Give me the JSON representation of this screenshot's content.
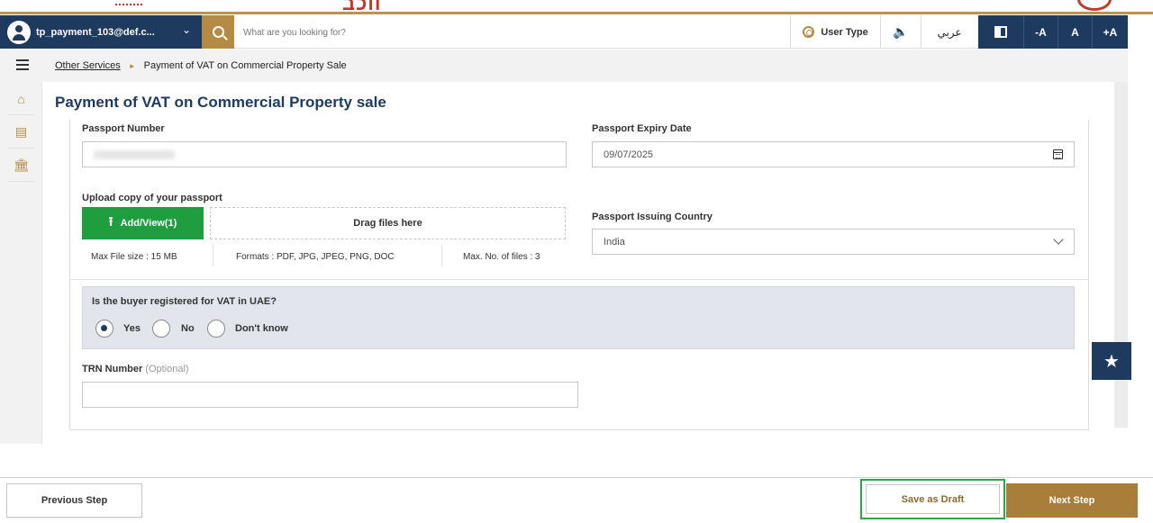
{
  "header": {
    "logo_fragment": "ווכב",
    "user_name": "tp_payment_103@def.c...",
    "search_placeholder": "What are you looking for?",
    "user_type": "User Type",
    "speaker_glyph": "🔈",
    "language": "عربي",
    "font_decrease": "-A",
    "font_reset": "A",
    "font_increase": "+A"
  },
  "breadcrumb": {
    "parent": "Other Services",
    "separator": "►",
    "current": "Payment of VAT on Commercial Property Sale"
  },
  "sidebar": {
    "items": [
      {
        "icon": "home-icon",
        "glyph": "⌂"
      },
      {
        "icon": "clipboard-icon",
        "glyph": "▤"
      },
      {
        "icon": "bank-icon",
        "glyph": "🏛"
      }
    ]
  },
  "page": {
    "title": "Payment of VAT on Commercial Property sale"
  },
  "form": {
    "passport_number": {
      "label": "Passport Number"
    },
    "passport_expiry": {
      "label": "Passport Expiry Date",
      "value": "09/07/2025"
    },
    "upload": {
      "label": "Upload copy of your passport",
      "button": "Add/View(1)",
      "drop_text": "Drag files here",
      "max_size": "Max File size : 15 MB",
      "formats": "Formats : PDF, JPG, JPEG, PNG, DOC",
      "max_files": "Max. No. of files : 3"
    },
    "issuing_country": {
      "label": "Passport Issuing Country",
      "value": "India"
    },
    "vat_question": {
      "label": "Is the buyer registered for VAT in UAE?",
      "options": [
        "Yes",
        "No",
        "Don't know"
      ],
      "selected": "Yes"
    },
    "trn": {
      "label": "TRN Number",
      "optional": "(Optional)",
      "value": ""
    }
  },
  "footer": {
    "previous": "Previous Step",
    "draft": "Save as Draft",
    "next": "Next Step"
  },
  "colors": {
    "navy": "#1f3a5f",
    "gold": "#b58a45",
    "green": "#1f9e3f"
  }
}
